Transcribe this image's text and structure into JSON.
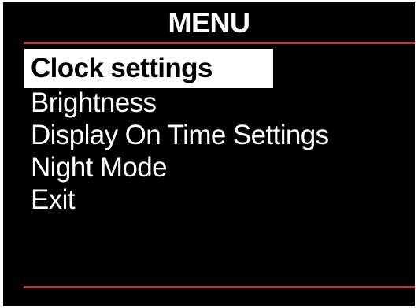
{
  "menu": {
    "title": "MENU",
    "items": [
      {
        "label": "Clock settings",
        "selected": true
      },
      {
        "label": "Brightness",
        "selected": false
      },
      {
        "label": "Display On Time Settings",
        "selected": false
      },
      {
        "label": "Night Mode",
        "selected": false
      },
      {
        "label": "Exit",
        "selected": false
      }
    ]
  },
  "colors": {
    "background": "#000000",
    "text": "#ffffff",
    "highlight": "#ffffff",
    "highlight_text": "#000000",
    "accent_rule": "#e0262b"
  }
}
